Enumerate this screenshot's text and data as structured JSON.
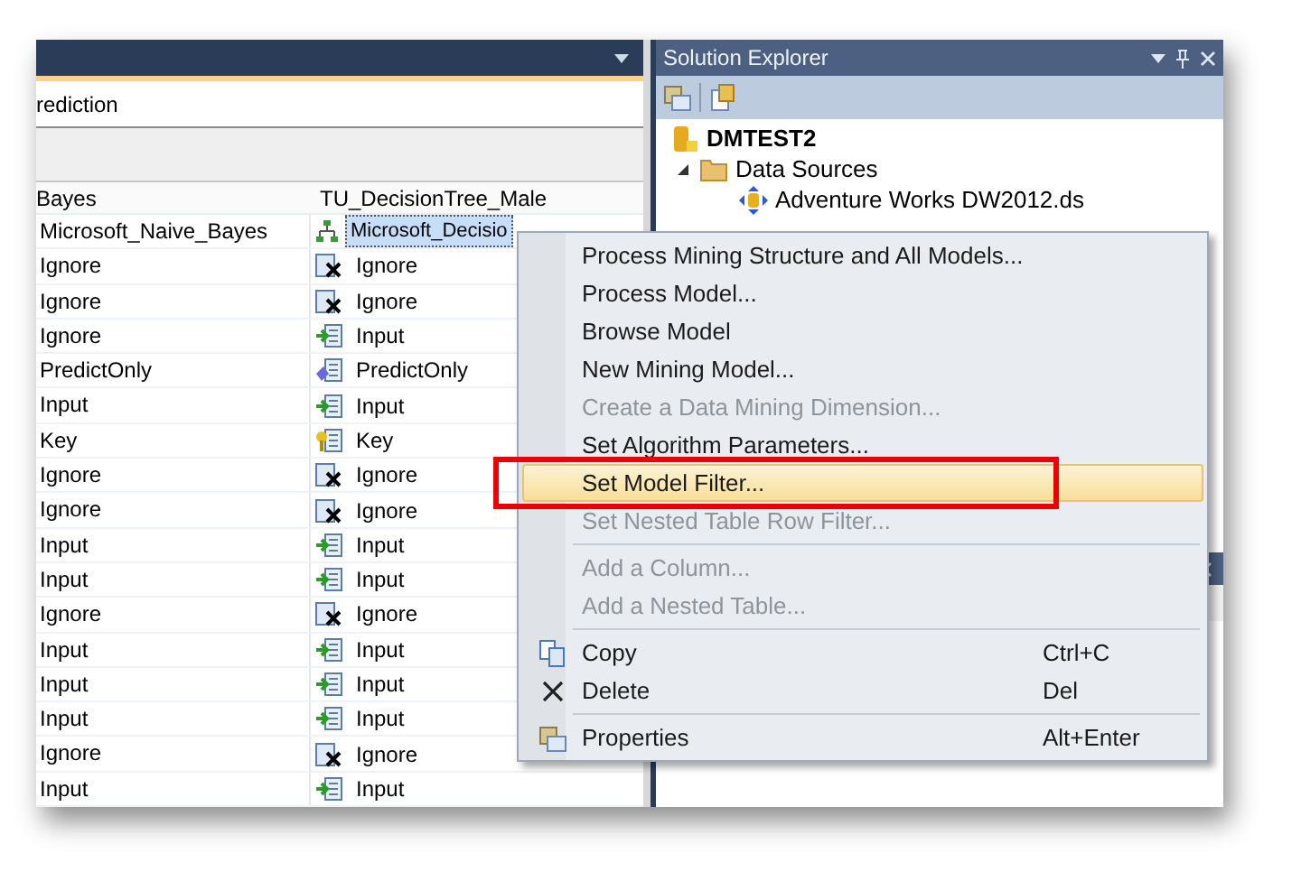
{
  "editor": {
    "tab_text": "rediction",
    "columns": [
      "Bayes",
      "TU_DecisionTree_Male"
    ],
    "rows": [
      {
        "col1": "Microsoft_Naive_Bayes",
        "col2": {
          "kind": "model",
          "text": "Microsoft_Decisio",
          "selected": true
        }
      },
      {
        "col1": "Ignore",
        "col2": {
          "kind": "ignore",
          "text": "Ignore",
          "selected": false
        }
      },
      {
        "col1": "Ignore",
        "col2": {
          "kind": "ignore",
          "text": "Ignore",
          "selected": false
        }
      },
      {
        "col1": "Ignore",
        "col2": {
          "kind": "input",
          "text": "Input",
          "selected": false
        }
      },
      {
        "col1": "PredictOnly",
        "col2": {
          "kind": "predict",
          "text": "PredictOnly",
          "selected": false
        }
      },
      {
        "col1": "Input",
        "col2": {
          "kind": "input",
          "text": "Input",
          "selected": false
        }
      },
      {
        "col1": "Key",
        "col2": {
          "kind": "key",
          "text": "Key",
          "selected": false
        }
      },
      {
        "col1": "Ignore",
        "col2": {
          "kind": "ignore",
          "text": "Ignore",
          "selected": false
        }
      },
      {
        "col1": "Ignore",
        "col2": {
          "kind": "ignore",
          "text": "Ignore",
          "selected": false
        }
      },
      {
        "col1": "Input",
        "col2": {
          "kind": "input",
          "text": "Input",
          "selected": false
        }
      },
      {
        "col1": "Input",
        "col2": {
          "kind": "input",
          "text": "Input",
          "selected": false
        }
      },
      {
        "col1": "Ignore",
        "col2": {
          "kind": "ignore",
          "text": "Ignore",
          "selected": false
        }
      },
      {
        "col1": "Input",
        "col2": {
          "kind": "input",
          "text": "Input",
          "selected": false
        }
      },
      {
        "col1": "Input",
        "col2": {
          "kind": "input",
          "text": "Input",
          "selected": false
        }
      },
      {
        "col1": "Input",
        "col2": {
          "kind": "input",
          "text": "Input",
          "selected": false
        }
      },
      {
        "col1": "Ignore",
        "col2": {
          "kind": "ignore",
          "text": "Ignore",
          "selected": false
        }
      },
      {
        "col1": "Input",
        "col2": {
          "kind": "input",
          "text": "Input",
          "selected": false
        }
      }
    ]
  },
  "solution_explorer": {
    "title": "Solution Explorer",
    "tree": [
      {
        "label": "DMTEST2",
        "kind": "project",
        "children": [
          {
            "label": "Data Sources",
            "kind": "folder",
            "expanded": true,
            "children": [
              {
                "label": "Adventure Works DW2012.ds",
                "kind": "datasource"
              }
            ]
          }
        ]
      }
    ]
  },
  "context_menu": [
    {
      "kind": "item",
      "label": "Process Mining Structure and All Models...",
      "disabled": false,
      "selected": false
    },
    {
      "kind": "item",
      "label": "Process Model...",
      "disabled": false,
      "selected": false
    },
    {
      "kind": "item",
      "label": "Browse Model",
      "disabled": false,
      "selected": false
    },
    {
      "kind": "item",
      "label": "New Mining Model...",
      "disabled": false,
      "selected": false
    },
    {
      "kind": "item",
      "label": "Create a Data Mining Dimension...",
      "disabled": true,
      "selected": false
    },
    {
      "kind": "item",
      "label": "Set Algorithm Parameters...",
      "disabled": false,
      "selected": false
    },
    {
      "kind": "item",
      "label": "Set Model Filter...",
      "disabled": false,
      "selected": true,
      "annotated": true
    },
    {
      "kind": "item",
      "label": "Set Nested Table Row Filter...",
      "disabled": true,
      "selected": false
    },
    {
      "kind": "separator"
    },
    {
      "kind": "item",
      "label": "Add a Column...",
      "disabled": true,
      "selected": false
    },
    {
      "kind": "item",
      "label": "Add a Nested Table...",
      "disabled": true,
      "selected": false
    },
    {
      "kind": "separator"
    },
    {
      "kind": "copy",
      "label": "Copy",
      "shortcut": "Ctrl+C",
      "disabled": false,
      "selected": false
    },
    {
      "kind": "delete",
      "label": "Delete",
      "shortcut": "Del",
      "disabled": false,
      "selected": false
    },
    {
      "kind": "separator"
    },
    {
      "kind": "properties",
      "label": "Properties",
      "shortcut": "Alt+Enter",
      "disabled": false,
      "selected": false
    }
  ]
}
